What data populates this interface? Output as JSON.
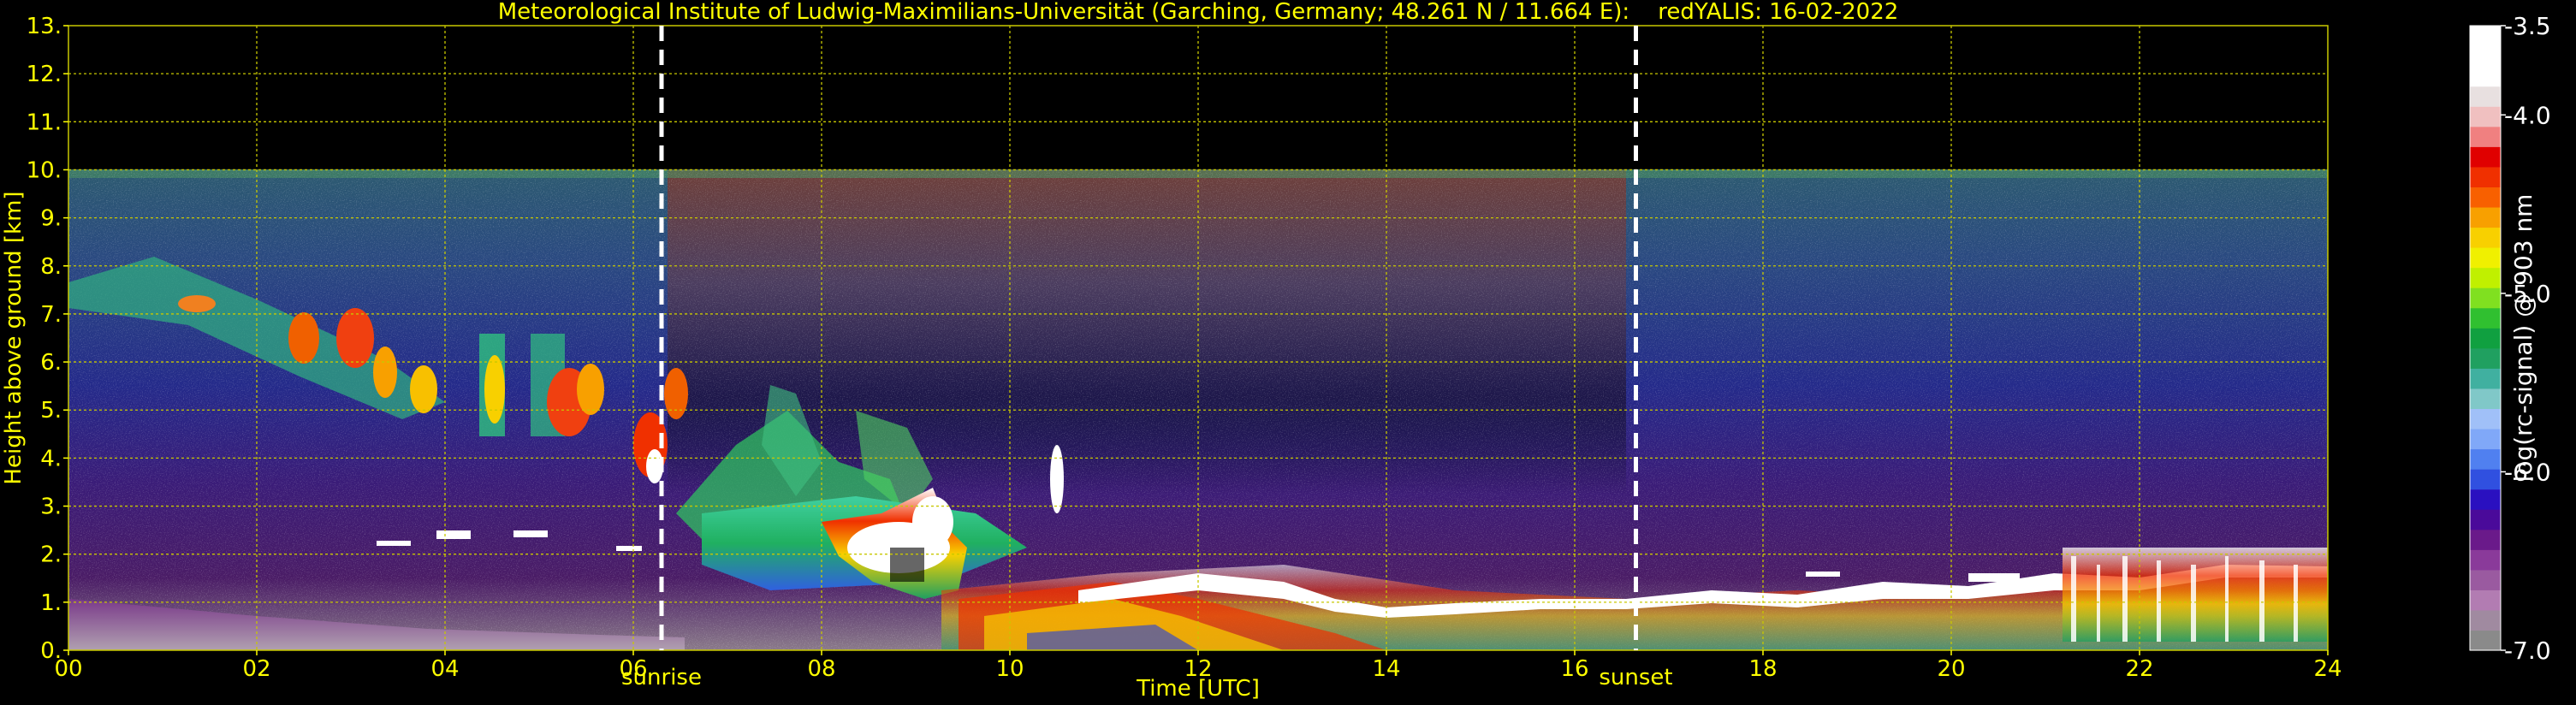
{
  "chart_data": {
    "type": "heatmap",
    "title": "Meteorological Institute of Ludwig-Maximilians-Universität (Garching, Germany; 48.261 N / 11.664 E):    redYALIS: 16-02-2022",
    "xlabel": "Time [UTC]",
    "ylabel": "Height above ground [km]",
    "xlim": [
      0,
      24
    ],
    "ylim": [
      0,
      13
    ],
    "x_ticks": [
      0,
      2,
      4,
      6,
      8,
      10,
      12,
      14,
      16,
      18,
      20,
      22,
      24
    ],
    "x_tick_labels": [
      "00",
      "02",
      "04",
      "06",
      "08",
      "10",
      "12",
      "14",
      "16",
      "18",
      "20",
      "22",
      "24"
    ],
    "y_ticks": [
      0,
      1,
      2,
      3,
      4,
      5,
      6,
      7,
      8,
      9,
      10,
      11,
      12,
      13
    ],
    "y_tick_labels": [
      "0.",
      "1.",
      "2.",
      "3.",
      "4.",
      "5.",
      "6.",
      "7.",
      "8.",
      "9.",
      "10.",
      "11.",
      "12.",
      "13."
    ],
    "grid": true,
    "data_top_km": 10,
    "events": [
      {
        "label": "sunrise",
        "x": 6.3
      },
      {
        "label": "sunset",
        "x": 16.65
      }
    ],
    "colorbar": {
      "label": "log(rc-signal) @ 903 nm",
      "range": [
        -7.0,
        -3.5
      ],
      "ticks": [
        -3.5,
        -4.0,
        -5.0,
        -6.0,
        -7.0
      ],
      "tick_labels": [
        "-3.5",
        "-4.0",
        "-5.0",
        "-6.0",
        "-7.0"
      ],
      "colors": [
        "#8a8a8a",
        "#a08aa0",
        "#b27cb2",
        "#9a5aa0",
        "#8a3a9a",
        "#6a1a8a",
        "#4a0a9a",
        "#2a10c0",
        "#3050e0",
        "#5080f0",
        "#80a8f8",
        "#a0c0f8",
        "#80c8c8",
        "#40b0a0",
        "#20a060",
        "#10a040",
        "#30c030",
        "#80e020",
        "#c0f000",
        "#f0f000",
        "#f8d000",
        "#f8a000",
        "#f86000",
        "#f03000",
        "#e00000",
        "#f08080",
        "#f0c0c0",
        "#e8e0e0",
        "#ffffff",
        "#ffffff",
        "#ffffff"
      ]
    }
  }
}
